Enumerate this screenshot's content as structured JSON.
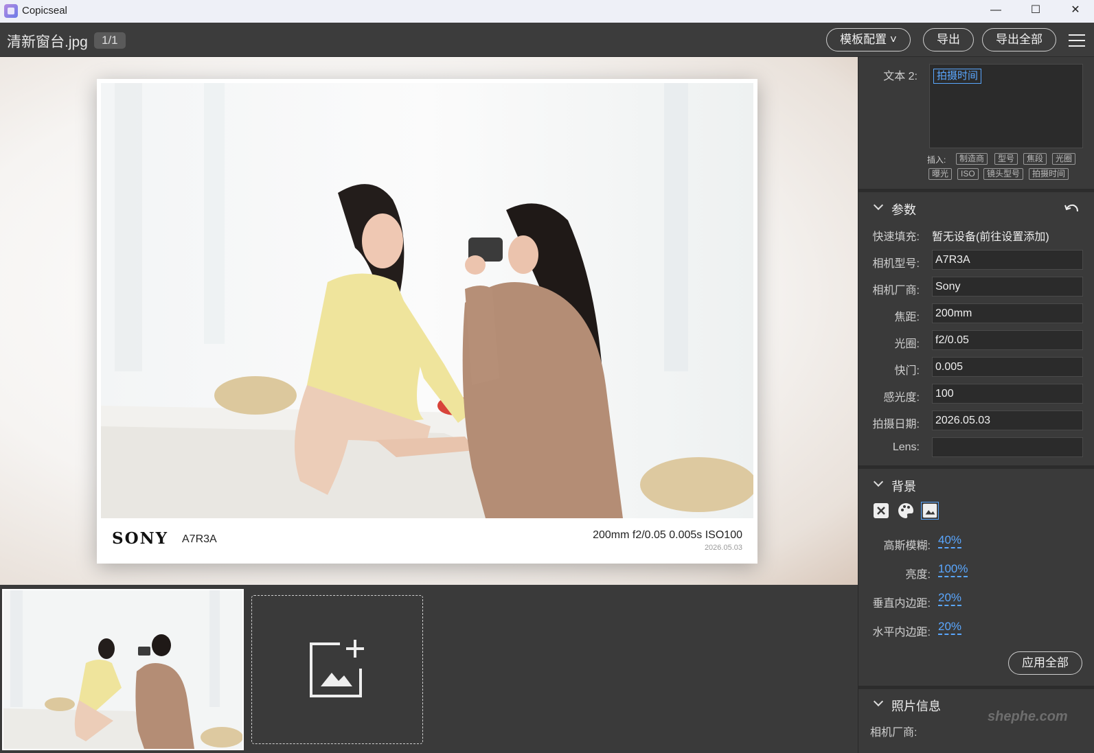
{
  "window": {
    "app_name": "Copicseal",
    "minimize": "—",
    "maximize": "☐",
    "close": "✕"
  },
  "toolbar": {
    "filename": "清新窗台.jpg",
    "counter": "1/1",
    "template_button": "模板配置 ˅",
    "export_button": "导出",
    "export_all_button": "导出全部"
  },
  "preview": {
    "brand": "SONY",
    "model": "A7R3A",
    "params": "200mm f2/0.05 0.005s ISO100",
    "date": "2026.05.03"
  },
  "panel": {
    "text2": {
      "label": "文本 2:",
      "chip": "拍摄时间",
      "insert_label": "插入:",
      "tags_row1": [
        "制造商",
        "型号",
        "焦段",
        "光圈"
      ],
      "tags_row2": [
        "曝光",
        "ISO",
        "镜头型号",
        "拍摄时间"
      ]
    },
    "params": {
      "title": "参数",
      "quick_fill_label": "快速填充:",
      "quick_fill_value": "暂无设备(前往设置添加)",
      "fields": [
        {
          "label": "相机型号:",
          "value": "A7R3A"
        },
        {
          "label": "相机厂商:",
          "value": "Sony"
        },
        {
          "label": "焦距:",
          "value": "200mm"
        },
        {
          "label": "光圈:",
          "value": "f2/0.05"
        },
        {
          "label": "快门:",
          "value": "0.005"
        },
        {
          "label": "感光度:",
          "value": "100"
        },
        {
          "label": "拍摄日期:",
          "value": "2026.05.03"
        },
        {
          "label": "Lens:",
          "value": ""
        }
      ]
    },
    "background": {
      "title": "背景",
      "selected_mode": "image",
      "rows": [
        {
          "label": "高斯模糊:",
          "value": "40%"
        },
        {
          "label": "亮度:",
          "value": "100%"
        },
        {
          "label": "垂直内边距:",
          "value": "20%"
        },
        {
          "label": "水平内边距:",
          "value": "20%"
        }
      ],
      "apply_all": "应用全部"
    },
    "photo_info": {
      "title": "照片信息",
      "maker_label": "相机厂商:"
    },
    "site_watermark": "shephe.com"
  },
  "colors": {
    "accent": "#5aa7ff",
    "panel_bg": "#3a3a3a",
    "field_bg": "#2b2b2b"
  }
}
